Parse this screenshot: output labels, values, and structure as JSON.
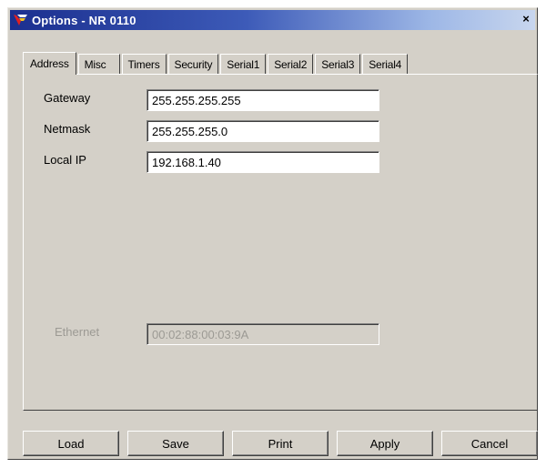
{
  "window": {
    "title": "Options - NR 0110",
    "close_glyph": "×",
    "icon": "app-logo-icon"
  },
  "tabs": [
    {
      "label": "Address",
      "active": true
    },
    {
      "label": "Misc",
      "active": false
    },
    {
      "label": "Timers",
      "active": false
    },
    {
      "label": "Security",
      "active": false
    },
    {
      "label": "Serial1",
      "active": false
    },
    {
      "label": "Serial2",
      "active": false
    },
    {
      "label": "Serial3",
      "active": false
    },
    {
      "label": "Serial4",
      "active": false
    }
  ],
  "address": {
    "gateway_label": "Gateway",
    "gateway_value": "255.255.255.255",
    "netmask_label": "Netmask",
    "netmask_value": "255.255.255.0",
    "localip_label": "Local IP",
    "localip_value": "192.168.1.40",
    "ethernet_label": "Ethernet",
    "ethernet_value": "00:02:88:00:03:9A"
  },
  "buttons": {
    "load": "Load",
    "save": "Save",
    "print": "Print",
    "apply": "Apply",
    "cancel": "Cancel"
  },
  "colors": {
    "titlebar_start": "#1b2f8f",
    "face": "#d4d0c8",
    "disabled_text": "#9c9a94"
  }
}
